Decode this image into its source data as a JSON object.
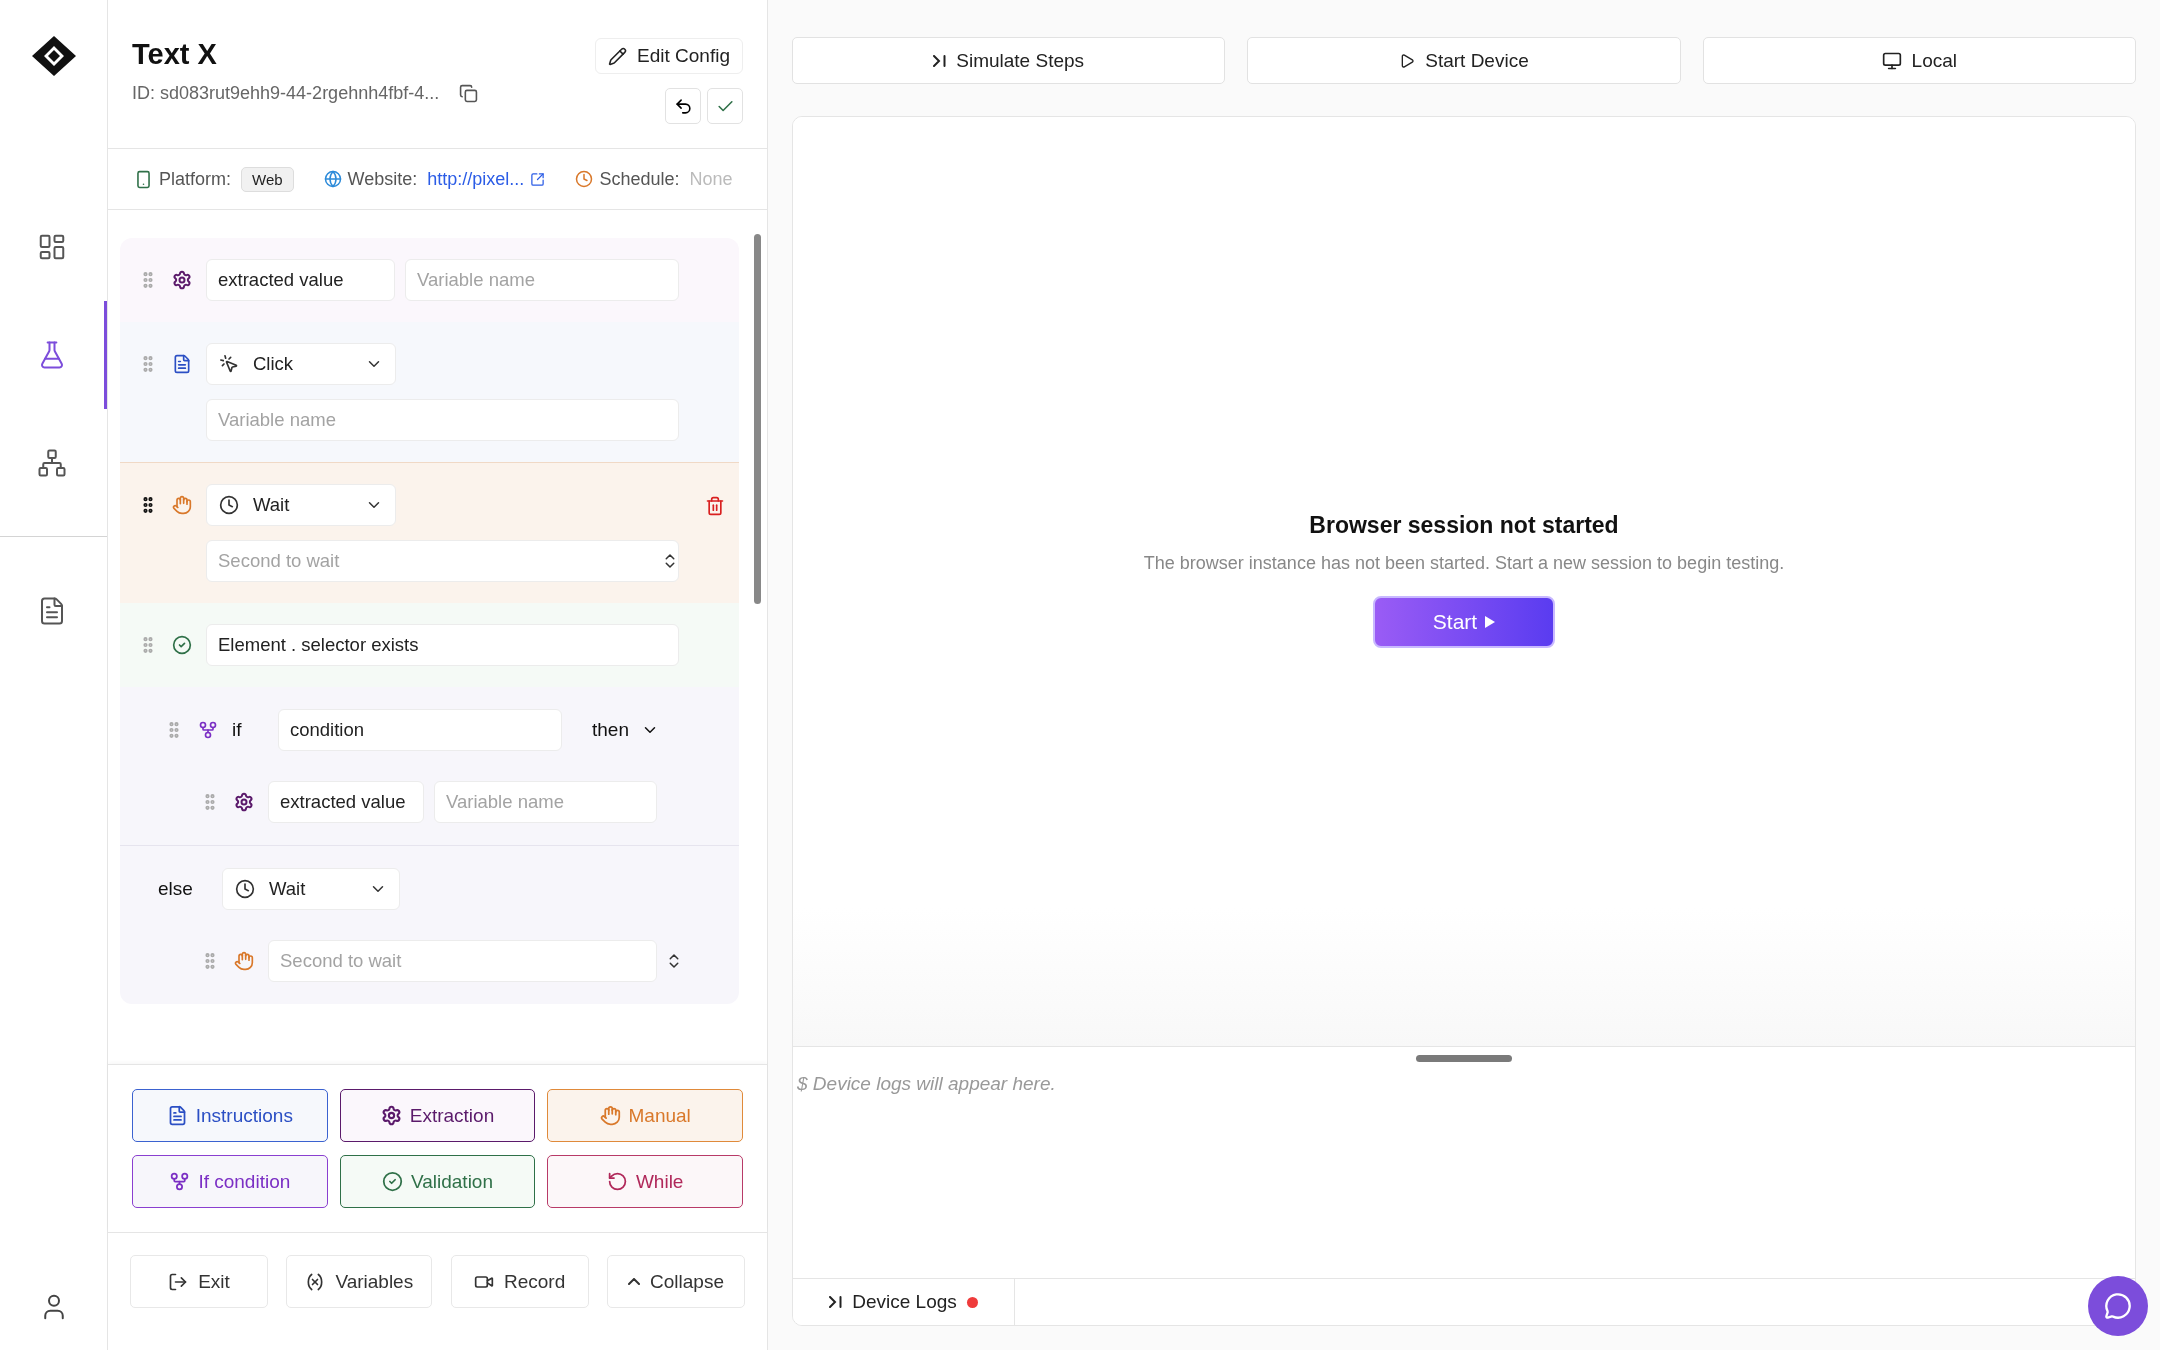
{
  "sidebar": {
    "items": [
      {
        "kind": "dashboard",
        "selected": false
      },
      {
        "kind": "flask",
        "selected": true
      },
      {
        "kind": "network",
        "selected": false
      },
      {
        "kind": "document",
        "selected": false
      }
    ]
  },
  "header": {
    "title": "Text X",
    "id": "ID: sd083rut9ehh9-44-2rgehnh4fbf-4...",
    "edit_button": "Edit Config"
  },
  "info": {
    "platform_label": "Platform:",
    "platform": "Web",
    "website_label": "Website:",
    "website": "http://pixel...",
    "schedule_label": "Schedule:",
    "schedule": "None"
  },
  "steps": [
    {
      "kind": "extraction",
      "selected": false,
      "value": "extracted value",
      "placeholder": "Variable name"
    },
    {
      "kind": "instruction",
      "selected": false,
      "action": {
        "kind": "click",
        "label": "Click"
      },
      "placeholder": "Variable name"
    },
    {
      "kind": "manual",
      "selected": true,
      "action": {
        "kind": "wait",
        "label": "Wait"
      },
      "placeholder": "Second to wait"
    },
    {
      "kind": "validation",
      "selected": false,
      "value": "Element . selector exists"
    },
    {
      "kind": "condition",
      "selected": false,
      "if_label": "if",
      "condition": "condition",
      "then_label": "then",
      "children": [
        {
          "kind": "extraction",
          "selected": false,
          "value": "extracted value",
          "placeholder": "Variable name"
        }
      ],
      "else_label": "else",
      "else_action": {
        "kind": "wait",
        "label": "Wait"
      },
      "else_children": [
        {
          "kind": "manual",
          "selected": false,
          "placeholder": "Second to wait"
        }
      ]
    }
  ],
  "palette": [
    {
      "kind": "instruction",
      "label": "Instructions"
    },
    {
      "kind": "extraction",
      "label": "Extraction"
    },
    {
      "kind": "manual",
      "label": "Manual"
    },
    {
      "kind": "condition",
      "label": "If condition"
    },
    {
      "kind": "validation",
      "label": "Validation"
    },
    {
      "kind": "while",
      "label": "While"
    }
  ],
  "actions": [
    {
      "kind": "exit",
      "label": "Exit"
    },
    {
      "kind": "variables",
      "label": "Variables"
    },
    {
      "kind": "record",
      "label": "Record"
    },
    {
      "kind": "collapse",
      "label": "Collapse"
    }
  ],
  "toolbar": [
    {
      "kind": "simulate",
      "label": "Simulate Steps"
    },
    {
      "kind": "start",
      "label": "Start Device"
    },
    {
      "kind": "local",
      "label": "Local"
    }
  ],
  "session": {
    "title": "Browser session not started",
    "message": "The browser instance has not been started. Start a new session to begin testing.",
    "button": "Start"
  },
  "logs": {
    "empty_message": "$ Device logs will appear here.",
    "tab": "Device Logs"
  }
}
